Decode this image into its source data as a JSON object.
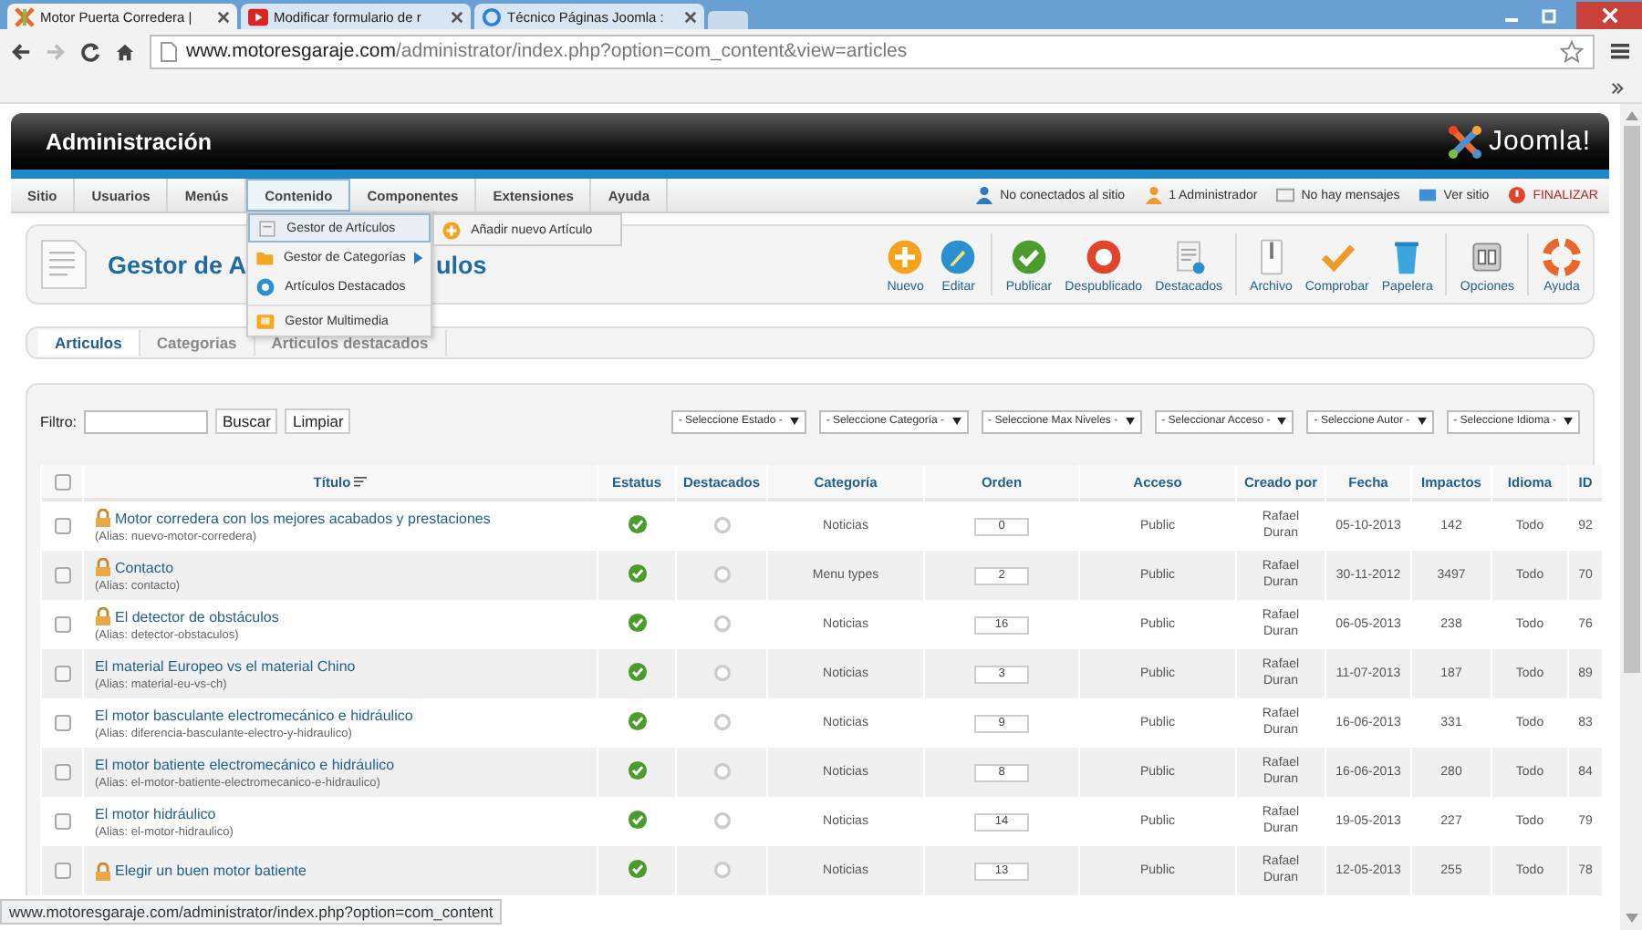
{
  "browser": {
    "tabs": [
      {
        "title": "Motor Puerta Corredera |",
        "selected": true
      },
      {
        "title": "Modificar formulario de r",
        "selected": false
      },
      {
        "title": "Técnico Páginas Joomla :",
        "selected": false
      }
    ],
    "url_host": "www.motoresgaraje.com",
    "url_path": "/administrator/index.php?option=com_content&view=articles"
  },
  "header": {
    "title": "Administración",
    "logo_text": "Joomla!"
  },
  "menu": [
    {
      "label": "Sitio",
      "selected": false
    },
    {
      "label": "Usuarios",
      "selected": false
    },
    {
      "label": "Menús",
      "selected": false
    },
    {
      "label": "Contenido",
      "selected": true
    },
    {
      "label": "Componentes",
      "selected": false
    },
    {
      "label": "Extensiones",
      "selected": false
    },
    {
      "label": "Ayuda",
      "selected": false
    }
  ],
  "dropdown": {
    "items": [
      {
        "label": "Gestor de Artículos",
        "selected": true,
        "has_submenu": false
      },
      {
        "label": "Gestor de Categorías",
        "selected": false,
        "has_submenu": true
      },
      {
        "label": "Artículos Destacados",
        "selected": false,
        "has_submenu": false
      },
      {
        "label": "Gestor Multimedia",
        "selected": false,
        "has_submenu": false
      }
    ],
    "submenu": [
      "Añadir nuevo Artículo"
    ]
  },
  "status_links": [
    "No conectados al sitio",
    "1 Administrador",
    "No hay mensajes",
    "Ver sitio",
    "FINALIZAR"
  ],
  "page_title_parts": [
    "Gestor de A",
    "ulos"
  ],
  "toolbar_groups": [
    {
      "buttons": [
        "Nuevo",
        "Editar"
      ]
    },
    {
      "buttons": [
        "Publicar",
        "Despublicado",
        "Destacados"
      ]
    },
    {
      "buttons": [
        "Archivo",
        "Comprobar",
        "Papelera"
      ]
    },
    {
      "buttons": [
        "Opciones"
      ]
    },
    {
      "buttons": [
        "Ayuda"
      ]
    }
  ],
  "subtabs": [
    {
      "label": "Articulos",
      "selected": true
    },
    {
      "label": "Categorias",
      "selected": false
    },
    {
      "label": "Articulos destacados",
      "selected": false
    }
  ],
  "filter": {
    "label": "Filtro:",
    "buttons": [
      "Buscar",
      "Limpiar"
    ],
    "selects": [
      "- Seleccione Estado -",
      "- Seleccione Categoría -",
      "- Seleccione Max Niveles -",
      "- Seleccionar Acceso -",
      "- Seleccione Autor -",
      "- Seleccione Idioma -"
    ]
  },
  "table": {
    "select_all_checked": false,
    "columns": [
      "Título",
      "Estatus",
      "Destacados",
      "Categoría",
      "Orden",
      "Acceso",
      "Creado por",
      "Fecha",
      "Impactos",
      "Idioma",
      "ID"
    ],
    "rows": [
      {
        "checked": false,
        "locked": true,
        "title": "Motor corredera con los mejores acabados y prestaciones",
        "alias": "(Alias: nuevo-motor-corredera)",
        "published": true,
        "featured": false,
        "category": "Noticias",
        "order": "0",
        "access": "Public",
        "author": "Rafael Duran",
        "date": "05-10-2013",
        "hits": "142",
        "language": "Todo",
        "id": "92"
      },
      {
        "checked": false,
        "locked": true,
        "title": "Contacto",
        "alias": "(Alias: contacto)",
        "published": true,
        "featured": false,
        "category": "Menu types",
        "order": "2",
        "access": "Public",
        "author": "Rafael Duran",
        "date": "30-11-2012",
        "hits": "3497",
        "language": "Todo",
        "id": "70"
      },
      {
        "checked": false,
        "locked": true,
        "title": "El detector de obstáculos",
        "alias": "(Alias: detector-obstaculos)",
        "published": true,
        "featured": false,
        "category": "Noticias",
        "order": "16",
        "access": "Public",
        "author": "Rafael Duran",
        "date": "06-05-2013",
        "hits": "238",
        "language": "Todo",
        "id": "76"
      },
      {
        "checked": false,
        "locked": false,
        "title": "El material Europeo vs el material Chino",
        "alias": "(Alias: material-eu-vs-ch)",
        "published": true,
        "featured": false,
        "category": "Noticias",
        "order": "3",
        "access": "Public",
        "author": "Rafael Duran",
        "date": "11-07-2013",
        "hits": "187",
        "language": "Todo",
        "id": "89"
      },
      {
        "checked": false,
        "locked": false,
        "title": "El motor basculante electromecánico e hidráulico",
        "alias": "(Alias: diferencia-basculante-electro-y-hidraulico)",
        "published": true,
        "featured": false,
        "category": "Noticias",
        "order": "9",
        "access": "Public",
        "author": "Rafael Duran",
        "date": "16-06-2013",
        "hits": "331",
        "language": "Todo",
        "id": "83"
      },
      {
        "checked": false,
        "locked": false,
        "title": "El motor batiente electromecánico e hidráulico",
        "alias": "(Alias: el-motor-batiente-electromecanico-e-hidraulico)",
        "published": true,
        "featured": false,
        "category": "Noticias",
        "order": "8",
        "access": "Public",
        "author": "Rafael Duran",
        "date": "16-06-2013",
        "hits": "280",
        "language": "Todo",
        "id": "84"
      },
      {
        "checked": false,
        "locked": false,
        "title": "El motor hidráulico",
        "alias": "(Alias: el-motor-hidraulico)",
        "published": true,
        "featured": false,
        "category": "Noticias",
        "order": "14",
        "access": "Public",
        "author": "Rafael Duran",
        "date": "19-05-2013",
        "hits": "227",
        "language": "Todo",
        "id": "79"
      },
      {
        "checked": false,
        "locked": true,
        "title": "Elegir un buen motor batiente",
        "published": true,
        "featured": false,
        "category": "Noticias",
        "order": "13",
        "access": "Public",
        "author": "Rafael Duran",
        "date": "12-05-2013",
        "hits": "255",
        "language": "Todo",
        "id": "78"
      }
    ]
  },
  "status_bar": "www.motoresgaraje.com/administrator/index.php?option=com_content"
}
